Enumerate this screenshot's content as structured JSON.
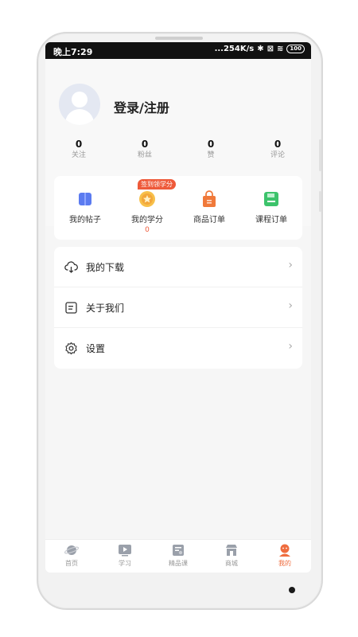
{
  "status_bar": {
    "time": "晚上7:29",
    "network": "...254K/s",
    "battery": "100"
  },
  "profile": {
    "login_label": "登录/注册"
  },
  "stats": [
    {
      "count": "0",
      "label": "关注"
    },
    {
      "count": "0",
      "label": "粉丝"
    },
    {
      "count": "0",
      "label": "赞"
    },
    {
      "count": "0",
      "label": "评论"
    }
  ],
  "quick_actions": {
    "badge": "签到领学分",
    "items": [
      {
        "label": "我的帖子",
        "icon": "book-icon",
        "color": "#5b7bf0"
      },
      {
        "label": "我的学分",
        "icon": "medal-icon",
        "color": "#f3a73b",
        "sub": "0"
      },
      {
        "label": "商品订单",
        "icon": "shopping-bag-icon",
        "color": "#f0793a"
      },
      {
        "label": "课程订单",
        "icon": "save-icon",
        "color": "#3cc36b"
      }
    ]
  },
  "menu": [
    {
      "label": "我的下载",
      "icon": "cloud-download-icon"
    },
    {
      "label": "关于我们",
      "icon": "info-doc-icon"
    },
    {
      "label": "设置",
      "icon": "gear-icon"
    }
  ],
  "tabbar": {
    "active_color": "#ef6c3e",
    "items": [
      {
        "label": "首页",
        "icon": "planet-icon"
      },
      {
        "label": "学习",
        "icon": "video-play-icon"
      },
      {
        "label": "精品课",
        "icon": "course-icon"
      },
      {
        "label": "商城",
        "icon": "store-icon"
      },
      {
        "label": "我的",
        "icon": "profile-icon",
        "active": true
      }
    ]
  }
}
